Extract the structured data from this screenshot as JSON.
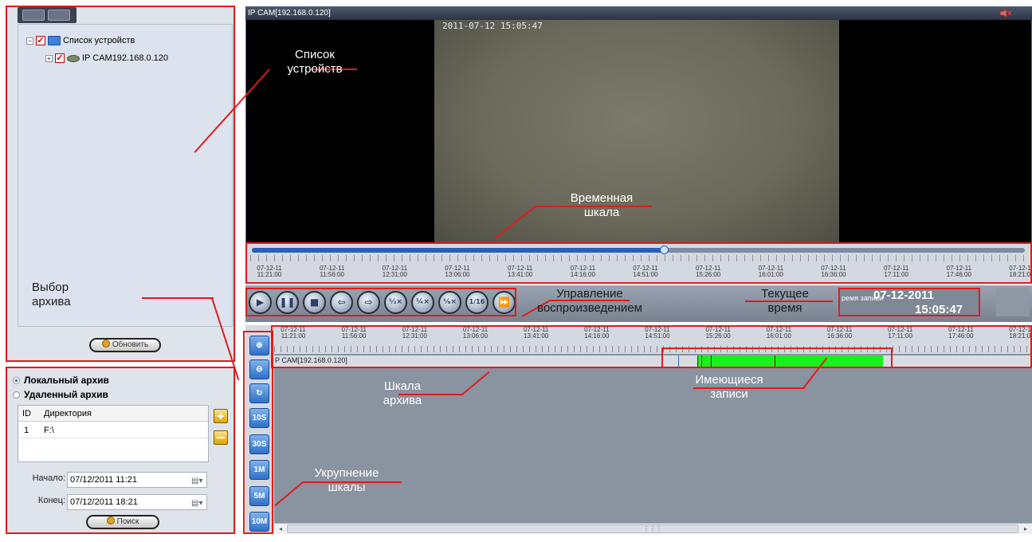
{
  "device_tree": {
    "root_label": "Список устройств",
    "child_label": "IP CAM192.168.0.120"
  },
  "left_panel": {
    "refresh_label": "Обновить",
    "local_archive_label": "Локальный архив",
    "remote_archive_label": "Удаленный архив",
    "table_headers": {
      "id": "ID",
      "dir": "Директория"
    },
    "table_rows": [
      {
        "id": "1",
        "dir": "F:\\"
      }
    ],
    "start_label": "Начало:",
    "start_value": "07/12/2011  11:21",
    "end_label": "Конец:",
    "end_value": "07/12/2011  18:21",
    "search_label": "Поиск"
  },
  "video": {
    "title": "IP CAM[192.168.0.120]",
    "timestamp": "2011-07-12 15:05:47"
  },
  "timeline": {
    "position_fraction": 0.534,
    "ticks": [
      [
        "07-12-11",
        "11:21:00"
      ],
      [
        "07-12-11",
        "11:56:00"
      ],
      [
        "07-12-11",
        "12:31:00"
      ],
      [
        "07-12-11",
        "13:06:00"
      ],
      [
        "07-12-11",
        "13:41:00"
      ],
      [
        "07-12-11",
        "14:16:00"
      ],
      [
        "07-12-11",
        "14:51:00"
      ],
      [
        "07-12-11",
        "15:26:00"
      ],
      [
        "07-12-11",
        "16:01:00"
      ],
      [
        "07-12-11",
        "16:36:00"
      ],
      [
        "07-12-11",
        "17:11:00"
      ],
      [
        "07-12-11",
        "17:46:00"
      ],
      [
        "07-12-11",
        "18:21:00"
      ]
    ]
  },
  "controls": {
    "buttons": [
      "play",
      "pause",
      "stop",
      "step-back",
      "step-forward",
      "speed-1/2",
      "speed-1/4",
      "speed-1/8",
      "speed-1/16",
      "fast-forward"
    ],
    "current_time_prefix": "ремя записи",
    "current_date": "07-12-2011",
    "current_time": "15:05:47"
  },
  "zoom_buttons": [
    "x2",
    "/2",
    "reset",
    "10S",
    "30S",
    "1M",
    "5M",
    "10M"
  ],
  "archive": {
    "channel_label": "P CAM[192.168.0.120]",
    "record_color": "#19f01e"
  },
  "annotations": {
    "device_list": "Список\nустройств",
    "timeline": "Временная\nшкала",
    "archive_select": "Выбор\nархива",
    "playback": "Управление\nвоспроизведением",
    "current_time": "Текущее\nвремя",
    "archive_scale": "Шкала\nархива",
    "records": "Имеющиеся\nзаписи",
    "zoom": "Укрупнение\nшкалы",
    "color": "#e11b1b"
  }
}
